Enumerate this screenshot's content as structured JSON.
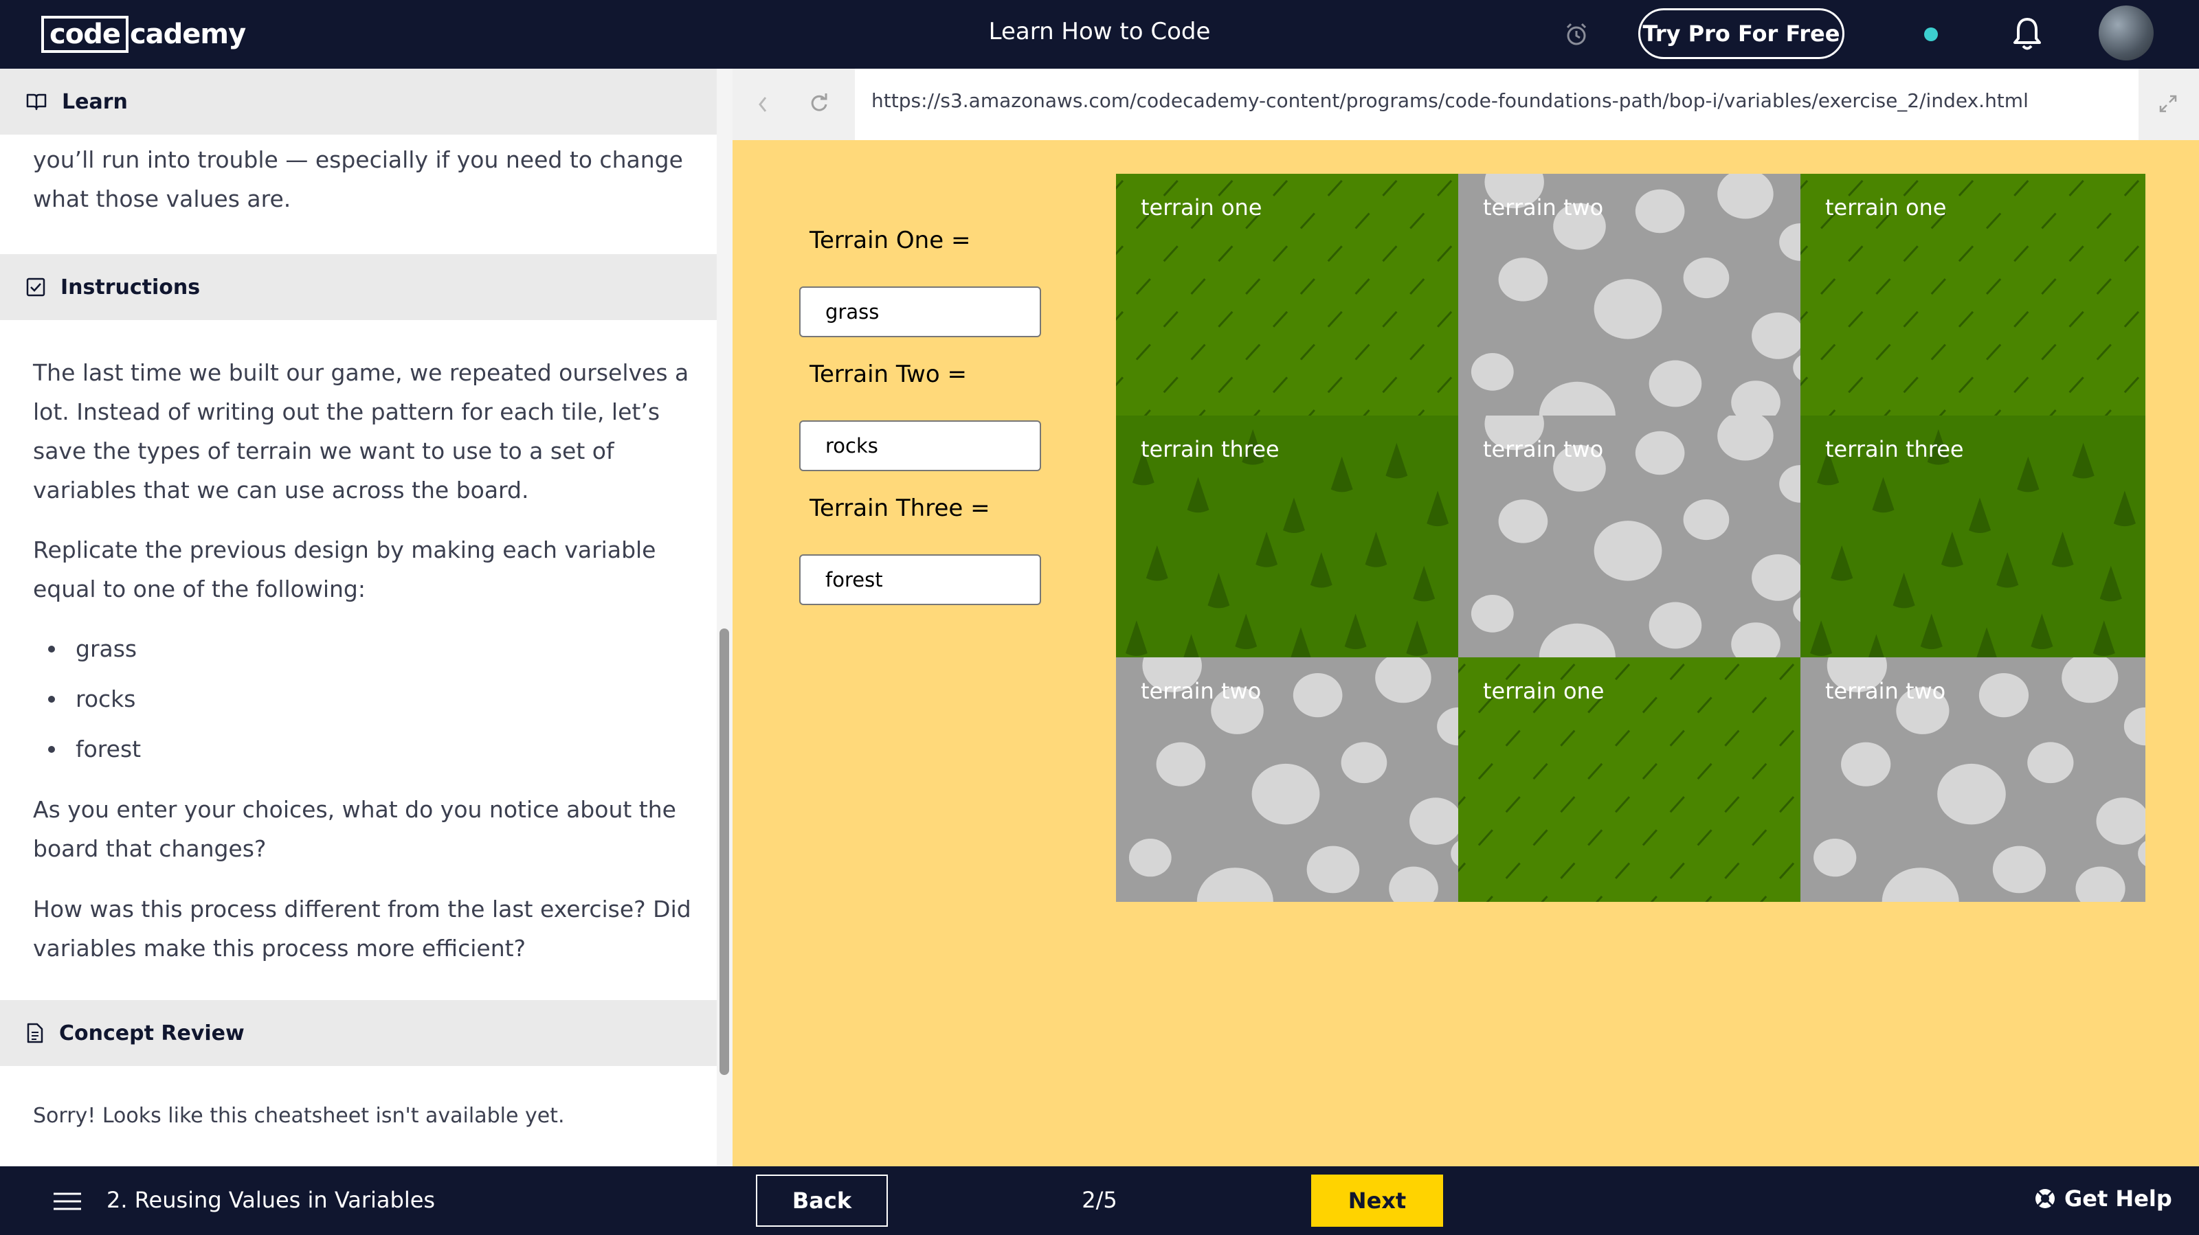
{
  "header": {
    "logo_part1": "code",
    "logo_part2": "cademy",
    "title": "Learn How to Code",
    "pro_button": "Try Pro For Free"
  },
  "left": {
    "learn_label": "Learn",
    "intro_text": "you’ll run into trouble — especially if you need to change what those values are.",
    "instructions_label": "Instructions",
    "paragraph1": "The last time we built our game, we repeated ourselves a lot. Instead of writing out the pattern for each tile, let’s save the types of terrain we want to use to a set of variables that we can use across the board.",
    "paragraph2": "Replicate the previous design by making each variable equal to one of the following:",
    "bullets": [
      "grass",
      "rocks",
      "forest"
    ],
    "paragraph3": "As you enter your choices, what do you notice about the board that changes?",
    "paragraph4": "How was this process different from the last exercise? Did variables make this process more efficient?",
    "concept_label": "Concept Review",
    "cheatsheet_text": "Sorry! Looks like this cheatsheet isn't available yet."
  },
  "browser": {
    "url": "https://s3.amazonaws.com/codecademy-content/programs/code-foundations-path/bop-i/variables/exercise_2/index.html"
  },
  "form": {
    "fields": [
      {
        "label": "Terrain One =",
        "value": "grass"
      },
      {
        "label": "Terrain Two =",
        "value": "rocks"
      },
      {
        "label": "Terrain Three =",
        "value": "forest"
      }
    ]
  },
  "board": {
    "tiles": [
      {
        "label": "terrain one",
        "type": "grass"
      },
      {
        "label": "terrain two",
        "type": "rocks"
      },
      {
        "label": "terrain one",
        "type": "grass"
      },
      {
        "label": "terrain three",
        "type": "forest"
      },
      {
        "label": "terrain two",
        "type": "rocks"
      },
      {
        "label": "terrain three",
        "type": "forest"
      },
      {
        "label": "terrain two",
        "type": "rocks"
      },
      {
        "label": "terrain one",
        "type": "grass"
      },
      {
        "label": "terrain two",
        "type": "rocks"
      }
    ]
  },
  "footer": {
    "lesson": "2. Reusing Values in Variables",
    "back": "Back",
    "progress": "2/5",
    "next": "Next",
    "help": "Get Help"
  },
  "colors": {
    "nav_bg": "#10162f",
    "stage_bg": "#ffd97a",
    "next_btn": "#ffd300",
    "grass": "#4a8500",
    "forest": "#3f7a00",
    "rocks_bg": "#9e9e9e",
    "rock": "#d6d6d6"
  }
}
